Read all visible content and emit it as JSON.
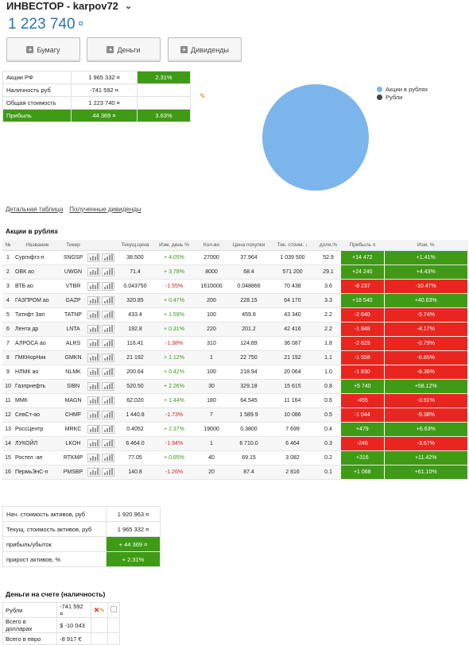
{
  "header": {
    "title": "ИНВЕСТОР - karpov72",
    "balance": "1 223 740",
    "currency_icon": "currency-sign-icon"
  },
  "buttons": {
    "securities": "Бумагу",
    "money": "Деньги",
    "dividends": "Дивиденды"
  },
  "summary": {
    "rows": [
      {
        "label": "Акции РФ",
        "value": "1 965 332 ¤",
        "extra": "2.31%"
      },
      {
        "label": "Наличность руб",
        "value": "-741 592 ¤",
        "extra": ""
      },
      {
        "label": "Общая стоимость",
        "value": "1 223 740 ¤",
        "extra": ""
      },
      {
        "label": "Прибыль",
        "value": "44 369 ¤",
        "extra": "3.63%"
      }
    ]
  },
  "pie": {
    "legend": [
      {
        "label": "Акции в рублях",
        "color": "#7cb5ec"
      },
      {
        "label": "Рубли",
        "color": "#434348"
      }
    ],
    "slices": [
      {
        "label": "Акции в рублях",
        "value": 100
      },
      {
        "label": "Рубли",
        "value": 0
      }
    ]
  },
  "links": {
    "detailed": "Детальная таблица",
    "dividends": "Полученные дивиденды"
  },
  "stocks_section": {
    "title": "Акции в рублях",
    "columns": [
      "№",
      "Название",
      "Тикер",
      "",
      "Текущ.цена",
      "Изм, день %",
      "Кол-во",
      "Цена покупки",
      "Тек. стоим.",
      "доля,%",
      "Прибыль ¤",
      "Изм, %"
    ],
    "sort_arrow": "↓",
    "rows": [
      {
        "n": "1",
        "name": "Сургнфгз-п",
        "ticker": "SNGSP",
        "price": "38.500",
        "day": "+ 4.05%",
        "qty": "27000",
        "buy": "37.964",
        "value": "1 039 500",
        "share": "52.9",
        "profit": "+14 472",
        "chg": "+1.41%"
      },
      {
        "n": "2",
        "name": "ОВК ао",
        "ticker": "UWGN",
        "price": "71.4",
        "day": "+ 3.78%",
        "qty": "8000",
        "buy": "68.4",
        "value": "571 200",
        "share": "29.1",
        "profit": "+24 240",
        "chg": "+4.43%"
      },
      {
        "n": "3",
        "name": "ВТБ ао",
        "ticker": "VTBR",
        "price": "0.043750",
        "day": "-1.55%",
        "qty": "1610000",
        "buy": "0.048866",
        "value": "70 438",
        "share": "3.6",
        "profit": "-8 237",
        "chg": "-10.47%"
      },
      {
        "n": "4",
        "name": "ГАЗПРОМ ао",
        "ticker": "GAZP",
        "price": "320.85",
        "day": "+ 0.47%",
        "qty": "200",
        "buy": "228.15",
        "value": "64 170",
        "share": "3.3",
        "profit": "+18 540",
        "chg": "+40.63%"
      },
      {
        "n": "5",
        "name": "Татнфт 3ап",
        "ticker": "TATNP",
        "price": "433.4",
        "day": "+ 1.59%",
        "qty": "100",
        "buy": "459.8",
        "value": "43 340",
        "share": "2.2",
        "profit": "-2 640",
        "chg": "-5.74%"
      },
      {
        "n": "6",
        "name": "Лента др",
        "ticker": "LNTA",
        "price": "192.8",
        "day": "+ 0.31%",
        "qty": "220",
        "buy": "201.2",
        "value": "42 416",
        "share": "2.2",
        "profit": "-1 848",
        "chg": "-4.17%"
      },
      {
        "n": "7",
        "name": "АЛРОСА ао",
        "ticker": "ALRS",
        "price": "116.41",
        "day": "-1.38%",
        "qty": "310",
        "buy": "124.89",
        "value": "36 087",
        "share": "1.8",
        "profit": "-2 629",
        "chg": "-6.79%"
      },
      {
        "n": "8",
        "name": "ГМКНорНик",
        "ticker": "GMKN",
        "price": "21 192",
        "day": "+ 1.12%",
        "qty": "1",
        "buy": "22 750",
        "value": "21 192",
        "share": "1.1",
        "profit": "-1 558",
        "chg": "-6.85%"
      },
      {
        "n": "9",
        "name": "НЛМК ао",
        "ticker": "NLMK",
        "price": "200.64",
        "day": "+ 0.42%",
        "qty": "100",
        "buy": "218.94",
        "value": "20 064",
        "share": "1.0",
        "profit": "-1 830",
        "chg": "-8.36%"
      },
      {
        "n": "10",
        "name": "Газпрнефть",
        "ticker": "SIBN",
        "price": "520.50",
        "day": "+ 2.26%",
        "qty": "30",
        "buy": "329.18",
        "value": "15 615",
        "share": "0.8",
        "profit": "+5 740",
        "chg": "+58.12%"
      },
      {
        "n": "11",
        "name": "ММК",
        "ticker": "MAGN",
        "price": "62.020",
        "day": "+ 1.44%",
        "qty": "180",
        "buy": "64.545",
        "value": "11 164",
        "share": "0.6",
        "profit": "-455",
        "chg": "-3.91%"
      },
      {
        "n": "12",
        "name": "СевСт-ао",
        "ticker": "CHMF",
        "price": "1 440.8",
        "day": "-1.73%",
        "qty": "7",
        "buy": "1 589.9",
        "value": "10 086",
        "share": "0.5",
        "profit": "-1 044",
        "chg": "-9.38%"
      },
      {
        "n": "13",
        "name": "РоссЦентр",
        "ticker": "MRKC",
        "price": "0.4052",
        "day": "+ 2.37%",
        "qty": "19000",
        "buy": "0.3800",
        "value": "7 699",
        "share": "0.4",
        "profit": "+479",
        "chg": "+6.63%"
      },
      {
        "n": "14",
        "name": "ЛУКОЙЛ",
        "ticker": "LKOH",
        "price": "6 464.0",
        "day": "-1.94%",
        "qty": "1",
        "buy": "6 710.0",
        "value": "6 464",
        "share": "0.3",
        "profit": "-246",
        "chg": "-3.67%"
      },
      {
        "n": "15",
        "name": "Ростел -ап",
        "ticker": "RTKMP",
        "price": "77.05",
        "day": "+ 0.65%",
        "qty": "40",
        "buy": "69.15",
        "value": "3 082",
        "share": "0.2",
        "profit": "+316",
        "chg": "+11.42%"
      },
      {
        "n": "16",
        "name": "ПермьЭнС-п",
        "ticker": "PMSBP",
        "price": "140.8",
        "day": "-1.26%",
        "qty": "20",
        "buy": "87.4",
        "value": "2 816",
        "share": "0.1",
        "profit": "+1 068",
        "chg": "+61.10%"
      }
    ]
  },
  "totals": {
    "rows": [
      {
        "label": "Нач. стоимость активов, руб",
        "value": "1 920 963 ¤"
      },
      {
        "label": "Текущ. стоимость активов, руб",
        "value": "1 965 332 ¤"
      },
      {
        "label": "прибыль/убыток",
        "value": "+ 44 369 ¤"
      },
      {
        "label": "прирост активов, %",
        "value": "+ 2.31%"
      }
    ]
  },
  "cash": {
    "title": "Деньги на счете (наличность)",
    "rows": [
      {
        "label": "Рубли",
        "value": "-741 592 ¤"
      },
      {
        "label": "Всего в долларах",
        "value": "$ -10 043"
      },
      {
        "label": "Всего в евро",
        "value": "-8 917 €"
      }
    ]
  }
}
